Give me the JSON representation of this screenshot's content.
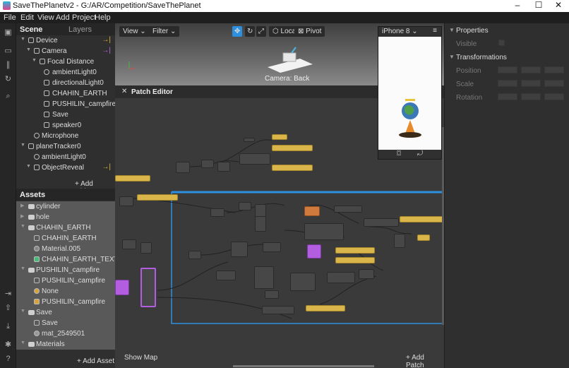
{
  "window": {
    "title": "SaveThePlanetv2 - G:/AR/Competition/SaveThePlanet",
    "min": "–",
    "max": "☐",
    "close": "✕"
  },
  "menu": [
    "File",
    "Edit",
    "View",
    "Add",
    "Project",
    "Help"
  ],
  "scene": {
    "tab_scene": "Scene",
    "tab_layers": "Layers",
    "items": [
      {
        "label": "Device"
      },
      {
        "label": "Camera"
      },
      {
        "label": "Focal Distance"
      },
      {
        "label": "ambientLight0"
      },
      {
        "label": "directionalLight0"
      },
      {
        "label": "CHAHIN_EARTH"
      },
      {
        "label": "PUSHILIN_campfire"
      },
      {
        "label": "Save"
      },
      {
        "label": "speaker0"
      },
      {
        "label": "Microphone"
      },
      {
        "label": "planeTracker0"
      },
      {
        "label": "ambientLight0"
      },
      {
        "label": "ObjectReveal"
      }
    ],
    "add_object": "+ Add Object"
  },
  "assets": {
    "title": "Assets",
    "items": [
      {
        "label": "cylinder"
      },
      {
        "label": "hole"
      },
      {
        "label": "CHAHIN_EARTH"
      },
      {
        "label": "CHAHIN_EARTH"
      },
      {
        "label": "Material.005"
      },
      {
        "label": "CHAHIN_EARTH_TEXTURE"
      },
      {
        "label": "PUSHILIN_campfire"
      },
      {
        "label": "PUSHILIN_campfire"
      },
      {
        "label": "None"
      },
      {
        "label": "PUSHILIN_campfire"
      },
      {
        "label": "Save"
      },
      {
        "label": "Save"
      },
      {
        "label": "mat_2549501"
      },
      {
        "label": "Materials"
      }
    ],
    "add_asset": "+ Add Asset"
  },
  "viewport": {
    "view": "View ⌄",
    "filter": "Filter ⌄",
    "local": "Local",
    "pivot": "Pivot",
    "camera_label": "Camera: Back"
  },
  "simulator": {
    "device": "iPhone 8 ⌄",
    "menu_icon": "≡"
  },
  "patch_editor": {
    "title": "Patch Editor",
    "close": "✕",
    "show_map": "Show Map",
    "add_patch": "+ Add Patch"
  },
  "properties": {
    "title": "Properties",
    "visible": "Visible",
    "transformations": "Transformations",
    "position": "Position",
    "scale": "Scale",
    "rotation": "Rotation"
  },
  "colors": {
    "accent_yellow": "#d9b54a",
    "accent_purple": "#b35de0",
    "selection_blue": "#2d8fe0"
  }
}
